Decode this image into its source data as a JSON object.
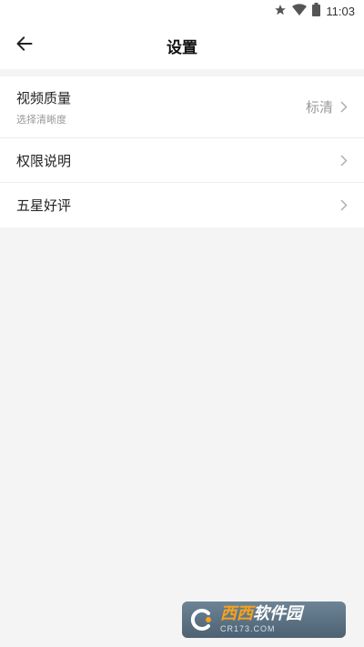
{
  "status_bar": {
    "time": "11:03",
    "icons": [
      "star-icon",
      "wifi-icon",
      "battery-icon"
    ]
  },
  "header": {
    "title": "设置",
    "back_icon": "arrow-left-icon"
  },
  "settings": {
    "items": [
      {
        "label": "视频质量",
        "sublabel": "选择清晰度",
        "value": "标清"
      },
      {
        "label": "权限说明"
      },
      {
        "label": "五星好评"
      }
    ]
  },
  "watermark": {
    "brand_accent": "西西",
    "brand_rest": "软件园",
    "url": "CR173.COM"
  },
  "colors": {
    "background": "#f4f4f4",
    "surface": "#ffffff",
    "primary_text": "#222222",
    "secondary_text": "#999999"
  }
}
